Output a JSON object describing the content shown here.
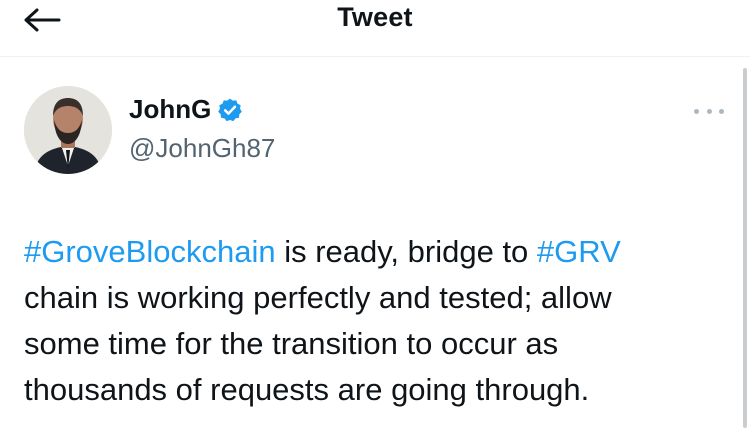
{
  "header": {
    "title": "Tweet",
    "back_icon": "arrow-left-icon"
  },
  "author": {
    "name": "JohnG",
    "handle": "@JohnGh87",
    "verified_icon": "verified-badge-icon",
    "verified_color": "#1d9bf0"
  },
  "more_icon": "more-horizontal-icon",
  "tweet": {
    "lines": [
      [
        {
          "text": "#GroveBlockchain",
          "type": "hashtag"
        },
        {
          "text": " is ready, bridge to ",
          "type": "text"
        },
        {
          "text": "#GRV",
          "type": "hashtag"
        }
      ],
      [
        {
          "text": "chain is working perfectly and tested; allow",
          "type": "text"
        }
      ],
      [
        {
          "text": "some time for the transition to occur as",
          "type": "text"
        }
      ],
      [
        {
          "text": "thousands of requests are going through.",
          "type": "text"
        }
      ]
    ]
  },
  "colors": {
    "link": "#1d9bf0",
    "text": "#0f1419",
    "secondary": "#536471"
  }
}
